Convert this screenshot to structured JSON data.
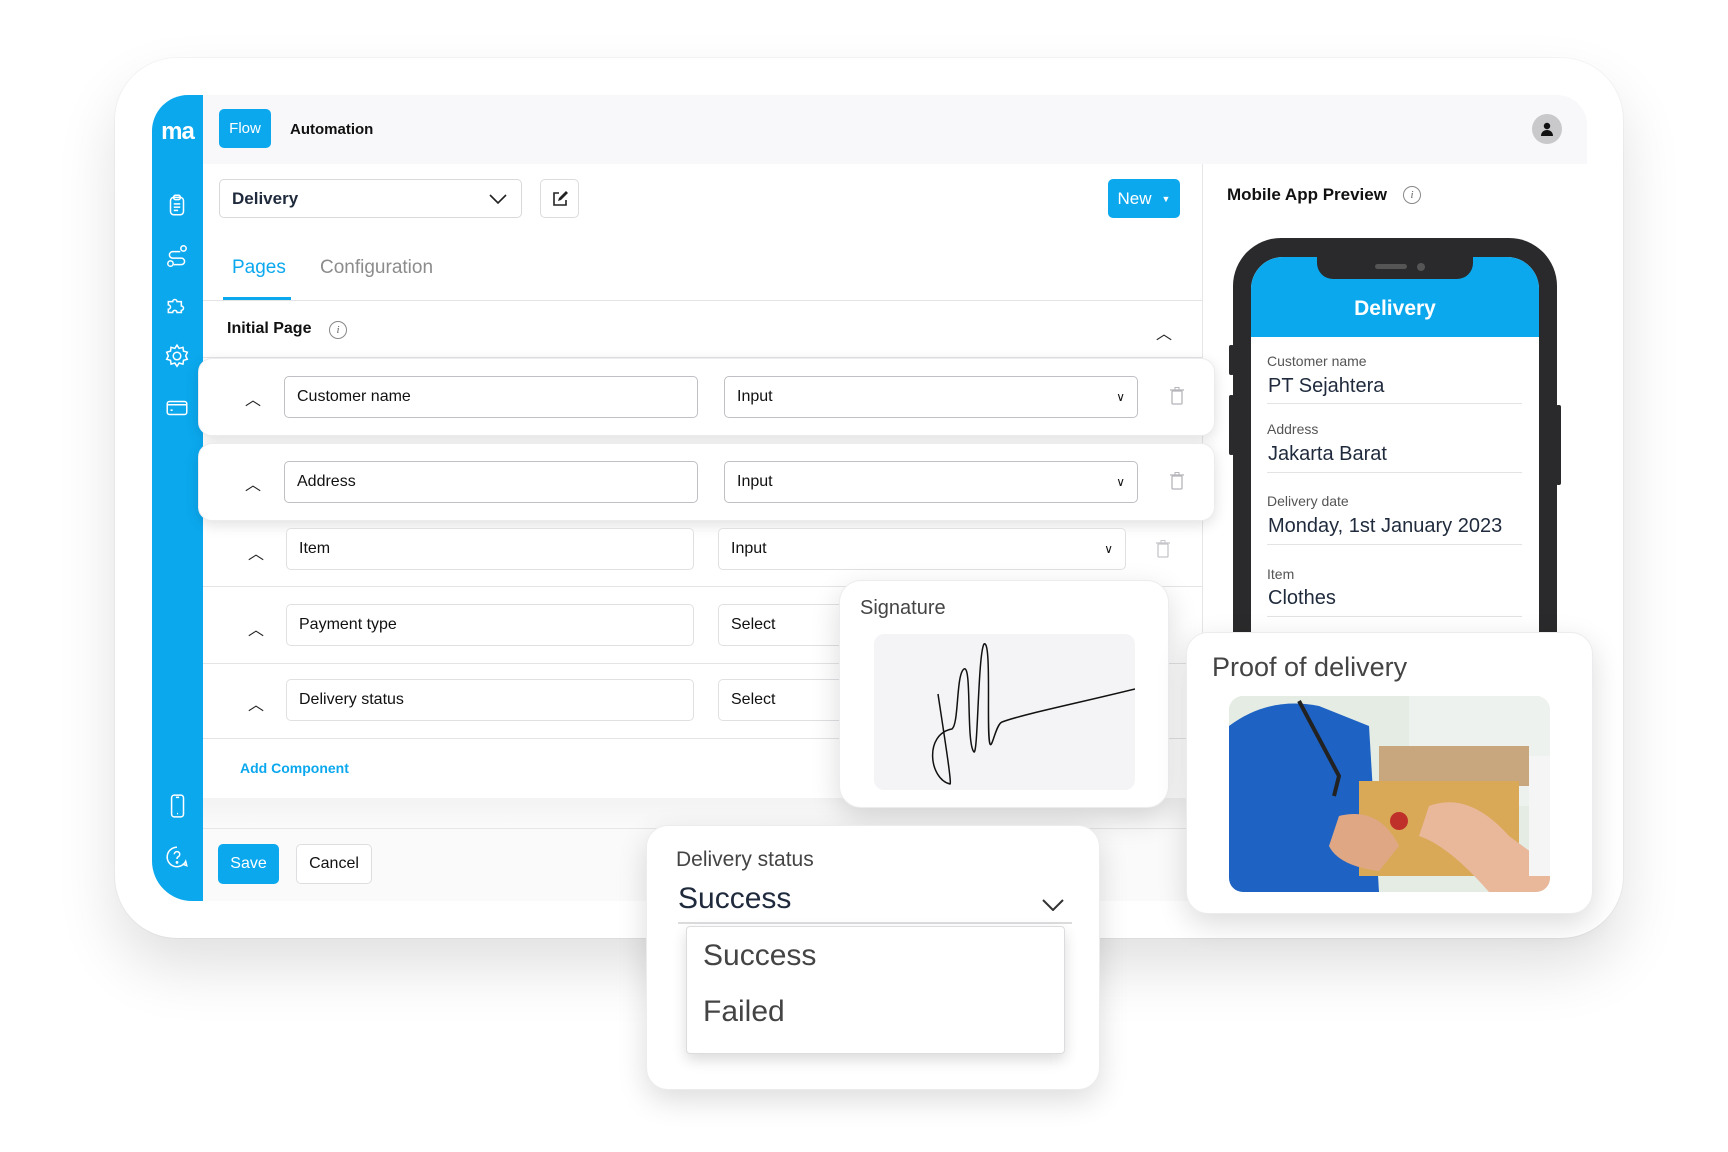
{
  "app": {
    "logo": "ma",
    "nav_tabs": [
      {
        "label": "Flow",
        "active": true
      },
      {
        "label": "Automation",
        "active": false
      }
    ],
    "sidebar_icons": [
      "clipboard-icon",
      "route-icon",
      "puzzle-icon",
      "gear-icon",
      "card-icon",
      "mobile-icon",
      "help-icon"
    ]
  },
  "toolbar": {
    "flow_select_value": "Delivery",
    "new_label": "New"
  },
  "tabs": [
    {
      "label": "Pages",
      "active": true
    },
    {
      "label": "Configuration",
      "active": false
    }
  ],
  "section": {
    "title": "Initial Page"
  },
  "components": [
    {
      "name": "Customer name",
      "type": "Input"
    },
    {
      "name": "Address",
      "type": "Input"
    },
    {
      "name": "Item",
      "type": "Input"
    },
    {
      "name": "Payment type",
      "type": "Select"
    },
    {
      "name": "Delivery status",
      "type": "Select"
    }
  ],
  "add_component_label": "Add Component",
  "footer": {
    "save_label": "Save",
    "cancel_label": "Cancel"
  },
  "preview": {
    "title": "Mobile App Preview",
    "phone_title": "Delivery",
    "fields": [
      {
        "label": "Customer name",
        "value": "PT Sejahtera"
      },
      {
        "label": "Address",
        "value": "Jakarta Barat"
      },
      {
        "label": "Delivery date",
        "value": "Monday, 1st January 2023"
      },
      {
        "label": "Item",
        "value": "Clothes"
      }
    ]
  },
  "signature_card": {
    "title": "Signature"
  },
  "proof_card": {
    "title": "Proof of delivery"
  },
  "status_card": {
    "label": "Delivery status",
    "value": "Success",
    "options": [
      "Success",
      "Failed"
    ]
  },
  "colors": {
    "accent": "#0ba8ee"
  }
}
